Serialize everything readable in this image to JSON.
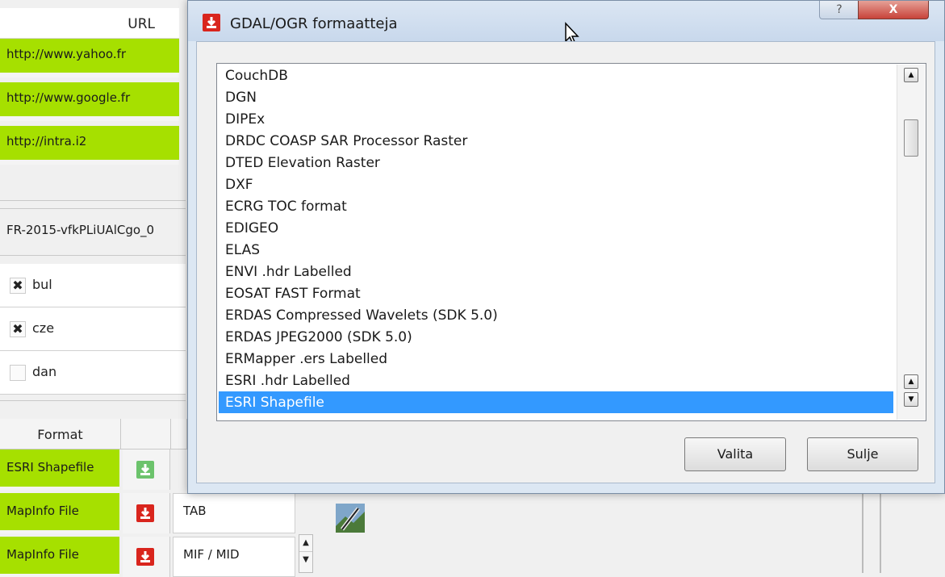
{
  "background_window": {
    "url_header": "URL",
    "urls": [
      "http://www.yahoo.fr",
      "http://www.google.fr",
      "http://intra.i2"
    ],
    "code_value": "FR-2015-vfkPLiUAlCgo_0",
    "languages": [
      {
        "label": "bul",
        "checked": true,
        "mark": "✖"
      },
      {
        "label": "cze",
        "checked": true,
        "mark": "✖"
      },
      {
        "label": "dan",
        "checked": false,
        "mark": ""
      }
    ],
    "format_table": {
      "header_format": "Format",
      "rows": [
        {
          "format": "ESRI Shapefile",
          "icon": "download-green-icon",
          "ext": ""
        },
        {
          "format": "MapInfo File",
          "icon": "download-red-icon",
          "ext": "TAB"
        },
        {
          "format": "MapInfo File",
          "icon": "download-red-icon",
          "ext": "MIF / MID"
        }
      ]
    }
  },
  "dialog": {
    "title": "GDAL/OGR formaatteja",
    "help_label": "?",
    "close_label": "X",
    "list_items": [
      "CouchDB",
      "DGN",
      "DIPEx",
      "DRDC COASP SAR Processor Raster",
      "DTED Elevation Raster",
      "DXF",
      "ECRG TOC format",
      "EDIGEO",
      "ELAS",
      "ENVI .hdr Labelled",
      "EOSAT FAST Format",
      "ERDAS Compressed Wavelets (SDK 5.0)",
      "ERDAS JPEG2000 (SDK 5.0)",
      "ERMapper .ers Labelled",
      "ESRI .hdr Labelled",
      "ESRI Shapefile"
    ],
    "selected_item": "ESRI Shapefile",
    "select_button": "Valita",
    "close_button": "Sulje"
  },
  "colors": {
    "accent_green": "#a6e000",
    "selection_blue": "#3399ff",
    "download_red": "#d9251d",
    "download_green": "#5cb85c"
  }
}
